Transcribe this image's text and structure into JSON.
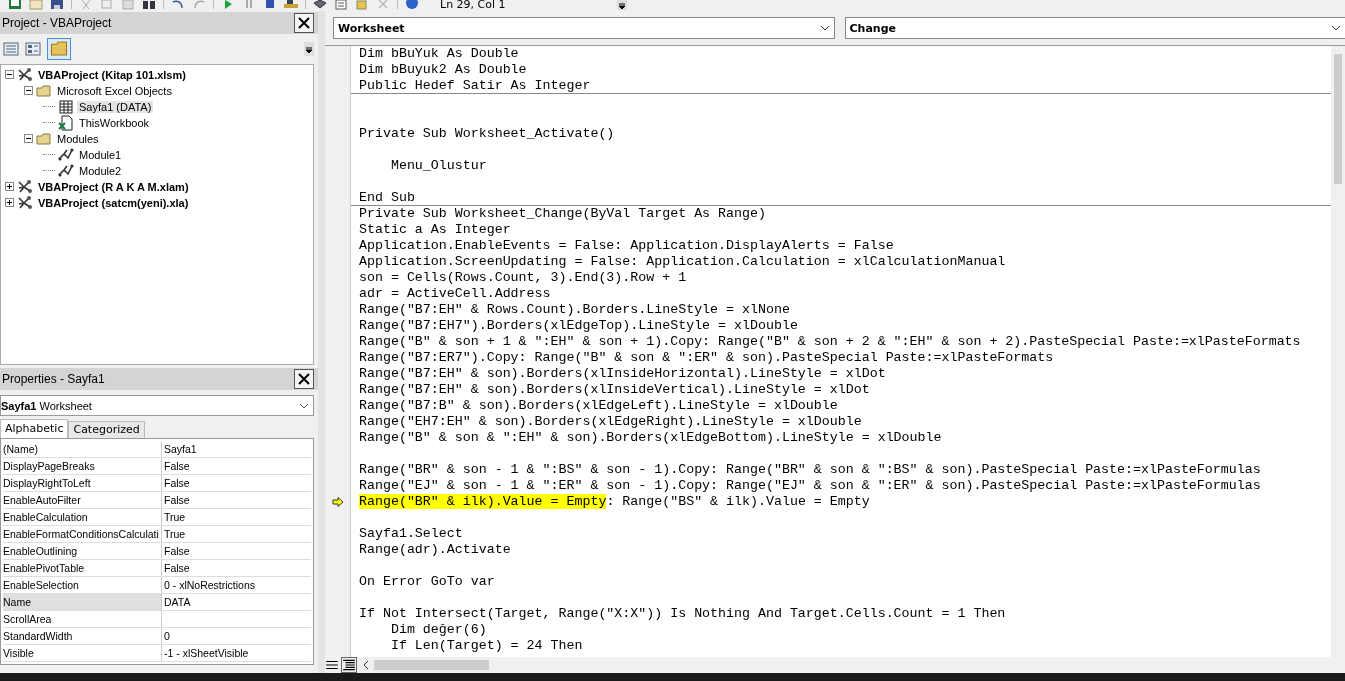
{
  "toolbar": {
    "position": "Ln 29, Col 1"
  },
  "project_panel": {
    "title": "Project - VBAProject",
    "tree": [
      {
        "label": "VBAProject (Kitap 101.xlsm)",
        "kind": "project",
        "expanded": true,
        "selected": false,
        "children": [
          {
            "label": "Microsoft Excel Objects",
            "kind": "folder",
            "expanded": true,
            "selected": false,
            "children": [
              {
                "label": "Sayfa1 (DATA)",
                "kind": "sheet",
                "selected": true
              },
              {
                "label": "ThisWorkbook",
                "kind": "workbook",
                "selected": false
              }
            ]
          },
          {
            "label": "Modules",
            "kind": "folder",
            "expanded": true,
            "selected": false,
            "children": [
              {
                "label": "Module1",
                "kind": "module",
                "selected": false
              },
              {
                "label": "Module2",
                "kind": "module",
                "selected": false
              }
            ]
          }
        ]
      },
      {
        "label": "VBAProject (R A K A M.xlam)",
        "kind": "project",
        "expanded": false,
        "selected": false
      },
      {
        "label": "VBAProject (satcm(yeni).xla)",
        "kind": "project",
        "expanded": false,
        "selected": false
      }
    ]
  },
  "properties_panel": {
    "title": "Properties - Sayfa1",
    "object_name": "Sayfa1",
    "object_type": "Worksheet",
    "tabs": [
      {
        "label": "Alphabetic",
        "selected": true
      },
      {
        "label": "Categorized",
        "selected": false
      }
    ],
    "rows": [
      {
        "name": "(Name)",
        "value": "Sayfa1",
        "selected": false
      },
      {
        "name": "DisplayPageBreaks",
        "value": "False",
        "selected": false
      },
      {
        "name": "DisplayRightToLeft",
        "value": "False",
        "selected": false
      },
      {
        "name": "EnableAutoFilter",
        "value": "False",
        "selected": false
      },
      {
        "name": "EnableCalculation",
        "value": "True",
        "selected": false
      },
      {
        "name": "EnableFormatConditionsCalculati",
        "value": "True",
        "selected": false
      },
      {
        "name": "EnableOutlining",
        "value": "False",
        "selected": false
      },
      {
        "name": "EnablePivotTable",
        "value": "False",
        "selected": false
      },
      {
        "name": "EnableSelection",
        "value": "0 - xlNoRestrictions",
        "selected": false
      },
      {
        "name": "Name",
        "value": "DATA",
        "selected": true
      },
      {
        "name": "ScrollArea",
        "selected": false
      },
      {
        "name": "StandardWidth",
        "value": "0",
        "selected": false
      },
      {
        "name": "Visible",
        "value": "-1 - xlSheetVisible",
        "selected": false
      }
    ]
  },
  "code_window": {
    "object": "Worksheet",
    "procedure": "Change",
    "procedures": [
      {
        "lines": [
          {
            "text": "Dim bBuYuk As Double",
            "current": false
          },
          {
            "text": "Dim bBuyuk2 As Double",
            "current": false
          },
          {
            "text": "Public Hedef Satir As Integer",
            "current": false
          }
        ]
      },
      {
        "lines": [
          {
            "current": false
          },
          {
            "current": false
          },
          {
            "text": "Private Sub Worksheet_Activate()",
            "current": false
          },
          {
            "current": false
          },
          {
            "text": "    Menu_Olustur",
            "current": false
          },
          {
            "current": false
          },
          {
            "text": "End Sub",
            "current": false
          }
        ]
      },
      {
        "lines": [
          {
            "text": "Private Sub Worksheet_Change(ByVal Target As Range)",
            "current": false
          },
          {
            "text": "Static a As Integer",
            "current": false
          },
          {
            "text": "Application.EnableEvents = False: Application.DisplayAlerts = False",
            "current": false
          },
          {
            "text": "Application.ScreenUpdating = False: Application.Calculation = xlCalculationManual",
            "current": false
          },
          {
            "text": "son = Cells(Rows.Count, 3).End(3).Row + 1",
            "current": false
          },
          {
            "text": "adr = ActiveCell.Address",
            "current": false
          },
          {
            "text": "Range(\"B7:EH\" & Rows.Count).Borders.LineStyle = xlNone",
            "current": false
          },
          {
            "text": "Range(\"B7:EH7\").Borders(xlEdgeTop).LineStyle = xlDouble",
            "current": false
          },
          {
            "text": "Range(\"B\" & son + 1 & \":EH\" & son + 1).Copy: Range(\"B\" & son + 2 & \":EH\" & son + 2).PasteSpecial Paste:=xlPasteFormats",
            "current": false
          },
          {
            "text": "Range(\"B7:ER7\").Copy: Range(\"B\" & son & \":ER\" & son).PasteSpecial Paste:=xlPasteFormats",
            "current": false
          },
          {
            "text": "Range(\"B7:EH\" & son).Borders(xlInsideHorizontal).LineStyle = xlDot",
            "current": false
          },
          {
            "text": "Range(\"B7:EH\" & son).Borders(xlInsideVertical).LineStyle = xlDot",
            "current": false
          },
          {
            "text": "Range(\"B7:B\" & son).Borders(xlEdgeLeft).LineStyle = xlDouble",
            "current": false
          },
          {
            "text": "Range(\"EH7:EH\" & son).Borders(xlEdgeRight).LineStyle = xlDouble",
            "current": false
          },
          {
            "text": "Range(\"B\" & son & \":EH\" & son).Borders(xlEdgeBottom).LineStyle = xlDouble",
            "current": false
          },
          {
            "current": false
          },
          {
            "text": "Range(\"BR\" & son - 1 & \":BS\" & son - 1).Copy: Range(\"BR\" & son & \":BS\" & son).PasteSpecial Paste:=xlPasteFormulas",
            "current": false
          },
          {
            "text": "Range(\"EJ\" & son - 1 & \":ER\" & son - 1).Copy: Range(\"EJ\" & son & \":ER\" & son).PasteSpecial Paste:=xlPasteFormulas",
            "current": false
          },
          {
            "highlighted": "Range(\"BR\" & ilk).Value = Empty",
            "text": ": Range(\"BS\" & ilk).Value = Empty",
            "current": true
          },
          {
            "current": false
          },
          {
            "text": "Sayfa1.Select",
            "current": false
          },
          {
            "text": "Range(adr).Activate",
            "current": false
          },
          {
            "current": false
          },
          {
            "text": "On Error GoTo var",
            "current": false
          },
          {
            "current": false
          },
          {
            "text": "If Not Intersect(Target, Range(\"X:X\")) Is Nothing And Target.Cells.Count = 1 Then",
            "current": false
          },
          {
            "text": "    Dim değer(6)",
            "current": false
          },
          {
            "text": "    If Len(Target) = 24 Then",
            "current": false
          }
        ]
      }
    ]
  }
}
